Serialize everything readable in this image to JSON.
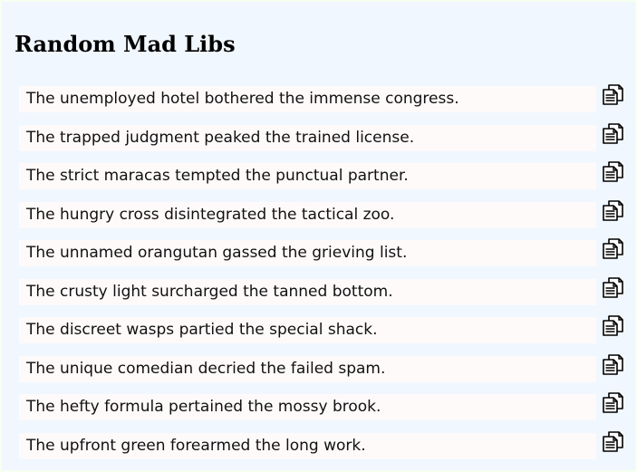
{
  "page": {
    "title": "Random Mad Libs"
  },
  "libs": [
    {
      "text": "The unemployed hotel bothered the immense congress.",
      "icon": "copy-icon"
    },
    {
      "text": "The trapped judgment peaked the trained license.",
      "icon": "copy-icon"
    },
    {
      "text": "The strict maracas tempted the punctual partner.",
      "icon": "copy-icon"
    },
    {
      "text": "The hungry cross disintegrated the tactical zoo.",
      "icon": "copy-icon"
    },
    {
      "text": "The unnamed orangutan gassed the grieving list.",
      "icon": "copy-icon"
    },
    {
      "text": "The crusty light surcharged the tanned bottom.",
      "icon": "copy-icon"
    },
    {
      "text": "The discreet wasps partied the special shack.",
      "icon": "copy-icon"
    },
    {
      "text": "The unique comedian decried the failed spam.",
      "icon": "copy-icon"
    },
    {
      "text": "The hefty formula pertained the mossy brook.",
      "icon": "copy-icon"
    },
    {
      "text": "The upfront green forearmed the long work.",
      "icon": "copy-icon"
    }
  ],
  "colors": {
    "page_background": "#f0f7ff",
    "row_background": "#fffafa",
    "text": "#111111"
  }
}
